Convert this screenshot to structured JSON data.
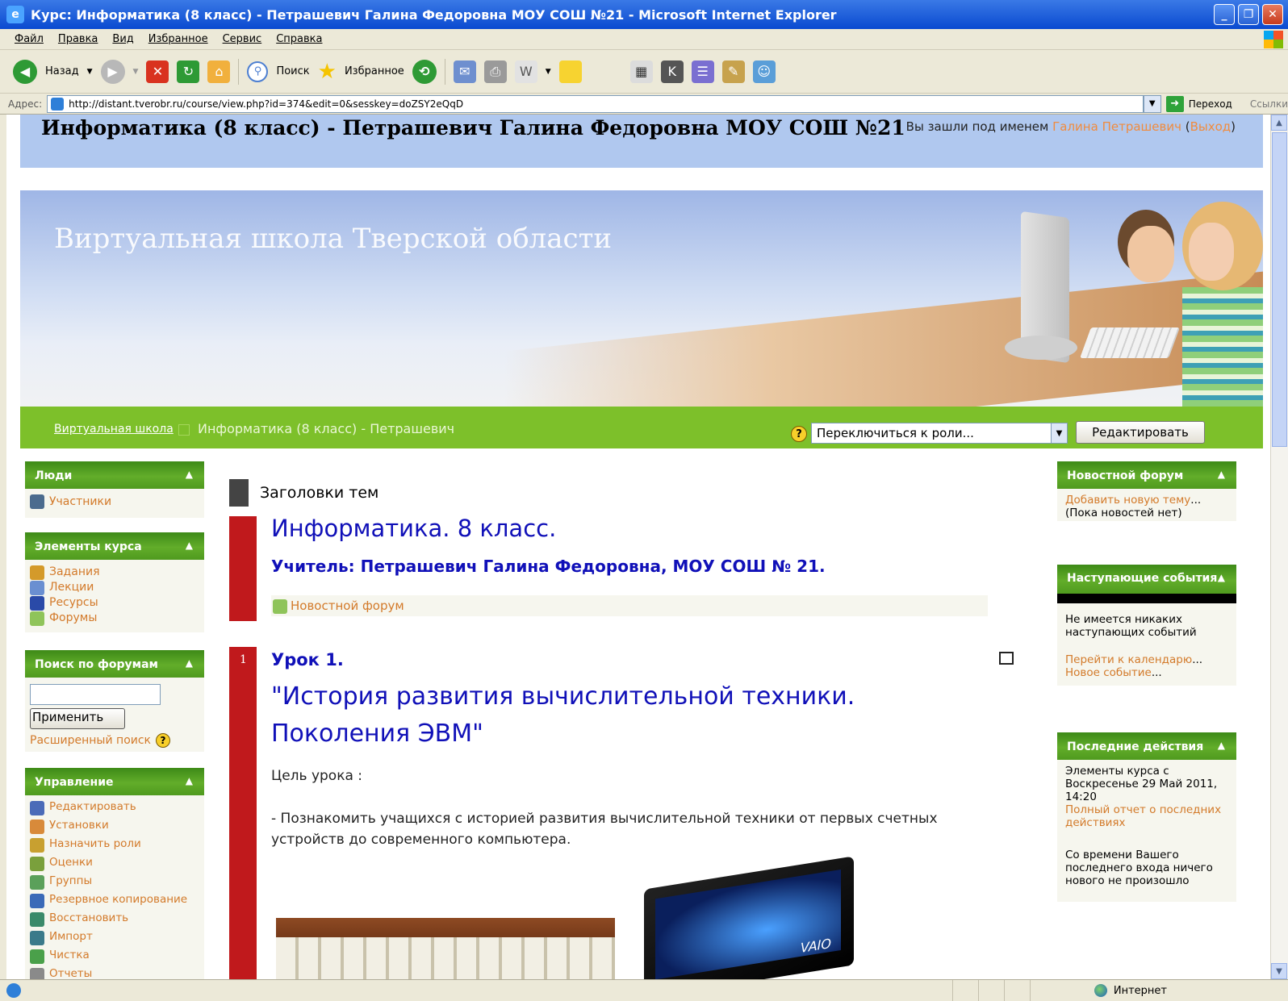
{
  "window": {
    "title": "Курс: Информатика (8 класс) - Петрашевич Галина Федоровна МОУ СОШ №21 - Microsoft Internet Explorer"
  },
  "menu": [
    "Файл",
    "Правка",
    "Вид",
    "Избранное",
    "Сервис",
    "Справка"
  ],
  "toolbar": {
    "back": "Назад",
    "search": "Поиск",
    "favorites": "Избранное"
  },
  "address": {
    "label": "Адрес:",
    "url": "http://distant.tverobr.ru/course/view.php?id=374&edit=0&sesskey=doZSY2eQqD",
    "go": "Переход",
    "links": "Ссылки"
  },
  "header": {
    "course_title": "Информатика (8 класс) - Петрашевич Галина Федоровна МОУ СОШ №21",
    "login_prefix": "Вы зашли под именем",
    "user": "Галина Петрашевич",
    "open_paren": "(",
    "logout": "Выход",
    "close_paren": ")"
  },
  "banner": {
    "title": "Виртуальная школа Тверской области"
  },
  "navbar": {
    "crumb_home": "Виртуальная школа",
    "crumb_course": "Информатика (8 класс) - Петрашевич",
    "role_select": "Переключиться к роли...",
    "edit_button": "Редактировать"
  },
  "left_blocks": {
    "people": {
      "title": "Люди",
      "items": [
        "Участники"
      ]
    },
    "activities": {
      "title": "Элементы курса",
      "items": [
        "Задания",
        "Лекции",
        "Ресурсы",
        "Форумы"
      ]
    },
    "search": {
      "title": "Поиск по форумам",
      "button": "Применить",
      "advanced": "Расширенный поиск"
    },
    "admin": {
      "title": "Управление",
      "items": [
        "Редактировать",
        "Установки",
        "Назначить роли",
        "Оценки",
        "Группы",
        "Резервное копирование",
        "Восстановить",
        "Импорт",
        "Чистка",
        "Отчеты"
      ]
    }
  },
  "main": {
    "topics_heading": "Заголовки тем",
    "course_heading": "Информатика. 8 класс.",
    "teacher": "Учитель: Петрашевич Галина Федоровна, МОУ СОШ № 21.",
    "news_forum": "Новостной форум",
    "section_num": "1",
    "lesson": "Урок 1.",
    "lesson_title_1": "\"История развития вычислительной техники.",
    "lesson_title_2": "Поколения ЭВМ\"",
    "goal": "Цель урока :",
    "goal_text": "- Познакомить учащихся с историей развития вычислительной техники от первых счетных устройств до современного компьютера."
  },
  "right_blocks": {
    "news": {
      "title": "Новостной форум",
      "add": "Добавить новую тему",
      "ellipsis": "...",
      "empty": "(Пока новостей нет)"
    },
    "events": {
      "title": "Наступающие события",
      "none": "Не имеется никаких наступающих событий",
      "calendar": "Перейти к календарю",
      "new_event": "Новое событие",
      "ellipsis": "..."
    },
    "recent": {
      "title": "Последние действия",
      "since": "Элементы курса с Воскресенье 29 Май 2011, 14:20",
      "report": "Полный отчет о последних действиях",
      "nothing": "Со времени Вашего последнего входа ничего нового не произошло"
    }
  },
  "status": {
    "zone": "Интернет"
  },
  "colors": {
    "accent_green": "#62ad2a",
    "section_red": "#c0191c",
    "link_orange": "#d37a2a",
    "heading_blue": "#1010b8",
    "header_blue": "#b0c8ef"
  }
}
